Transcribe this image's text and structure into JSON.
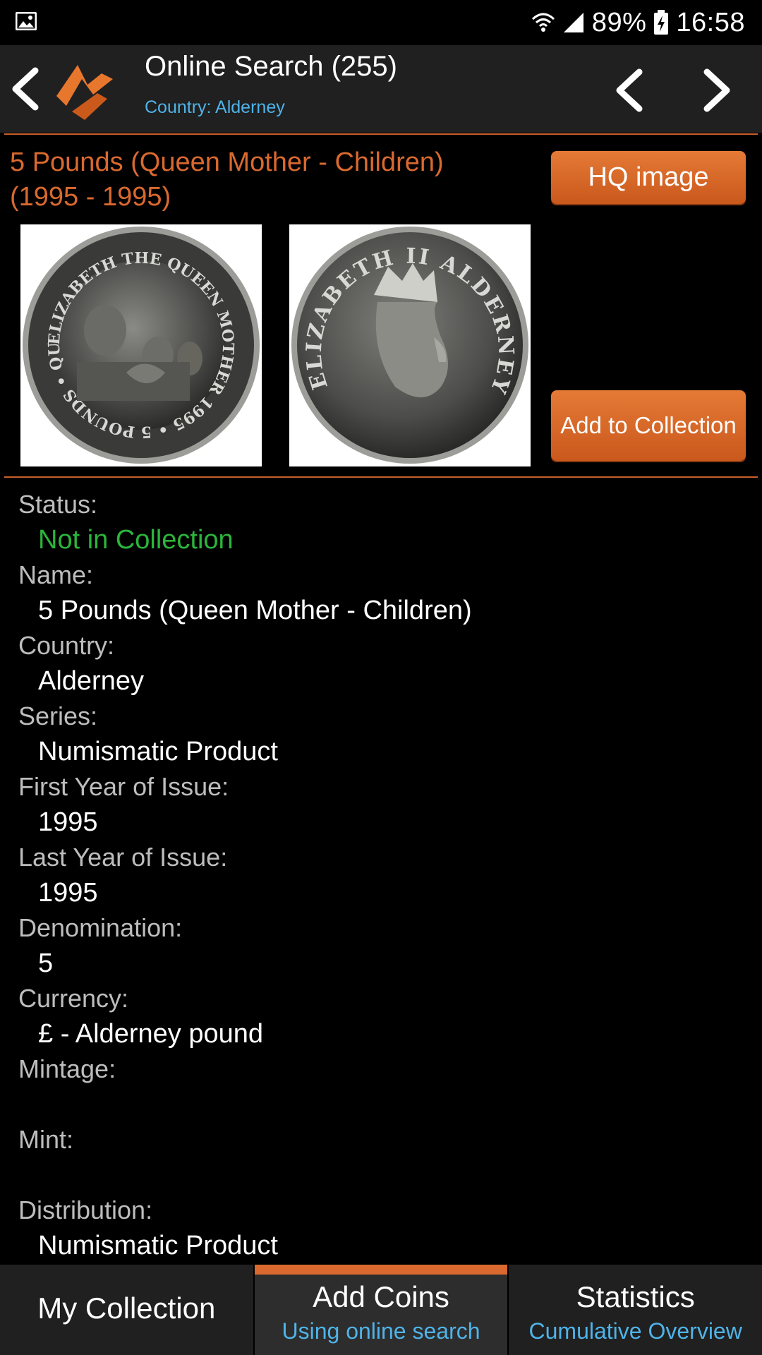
{
  "status_bar": {
    "battery": "89%",
    "time": "16:58"
  },
  "action_bar": {
    "title": "Online Search (255)",
    "subtitle": "Country: Alderney"
  },
  "coin": {
    "title_line1": "5 Pounds (Queen Mother - Children)",
    "title_line2": "(1995 - 1995)",
    "hq_button": "HQ image",
    "add_button": "Add to Collection",
    "obverse_legend": "ELIZABETH THE QUEEN MOTHER 1995 • 5 POUNDS • QUEEN",
    "reverse_legend": "ELIZABETH II ALDERNEY"
  },
  "details": [
    {
      "label": "Status:",
      "value": "Not in Collection",
      "highlight": true
    },
    {
      "label": "Name:",
      "value": "5 Pounds (Queen Mother - Children)"
    },
    {
      "label": "Country:",
      "value": "Alderney"
    },
    {
      "label": "Series:",
      "value": "Numismatic Product"
    },
    {
      "label": "First Year of Issue:",
      "value": "1995"
    },
    {
      "label": "Last Year of Issue:",
      "value": "1995"
    },
    {
      "label": "Denomination:",
      "value": "5"
    },
    {
      "label": "Currency:",
      "value": "£ - Alderney pound"
    },
    {
      "label": "Mintage:",
      "value": ""
    },
    {
      "label": "Mint:",
      "value": ""
    },
    {
      "label": "Distribution:",
      "value": "Numismatic Product"
    }
  ],
  "bottom_nav": {
    "tab1": {
      "label": "My Collection"
    },
    "tab2": {
      "label": "Add Coins",
      "sub": "Using online search"
    },
    "tab3": {
      "label": "Statistics",
      "sub": "Cumulative Overview"
    }
  },
  "colors": {
    "accent": "#d9692f",
    "link": "#4fb3e8",
    "status_green": "#2bb53b",
    "bar_bg": "#202020"
  }
}
